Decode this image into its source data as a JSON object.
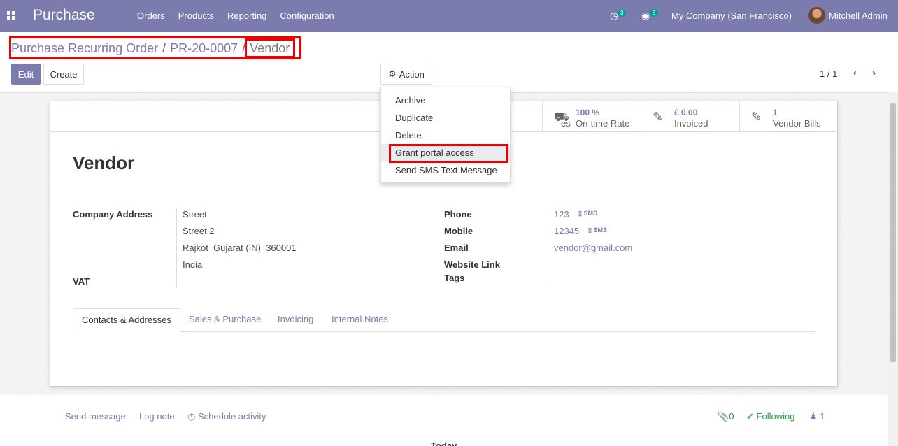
{
  "navbar": {
    "app_name": "Purchase",
    "menu": [
      "Orders",
      "Products",
      "Reporting",
      "Configuration"
    ],
    "activity_count": "3",
    "message_count": "5",
    "company": "My Company (San Francisco)",
    "user": "Mitchell Admin",
    "color": "#7c7bad"
  },
  "breadcrumb": {
    "items": [
      "Purchase Recurring Order",
      "PR-20-0007"
    ],
    "separator": "/",
    "current": "Vendor"
  },
  "toolbar": {
    "edit_label": "Edit",
    "create_label": "Create",
    "action_label": "Action",
    "pager": "1 / 1"
  },
  "dropdown": {
    "items": [
      "Archive",
      "Duplicate",
      "Delete",
      "Grant portal access",
      "Send SMS Text Message"
    ]
  },
  "stats": {
    "partial_label": "es",
    "ontime_value": "100 %",
    "ontime_label": "On-time Rate",
    "invoiced_value": "£ 0.00",
    "invoiced_label": "Invoiced",
    "bills_value": "1",
    "bills_label": "Vendor Bills"
  },
  "record": {
    "title": "Vendor",
    "company_address_label": "Company Address",
    "street": "Street",
    "street2": "Street 2",
    "city_line": "Rajkot  Gujarat (IN)  360001",
    "country": "India",
    "vat_label": "VAT",
    "phone_label": "Phone",
    "phone": "123",
    "mobile_label": "Mobile",
    "mobile": "12345",
    "sms_label": "SMS",
    "email_label": "Email",
    "email": "vendor@gmail.com",
    "website_label": "Website Link",
    "tags_label": "Tags"
  },
  "tabs": [
    "Contacts & Addresses",
    "Sales & Purchase",
    "Invoicing",
    "Internal Notes"
  ],
  "chatter": {
    "send_message": "Send message",
    "log_note": "Log note",
    "schedule_activity": "Schedule activity",
    "attachments": "0",
    "following": "Following",
    "followers": "1",
    "today": "Today"
  }
}
